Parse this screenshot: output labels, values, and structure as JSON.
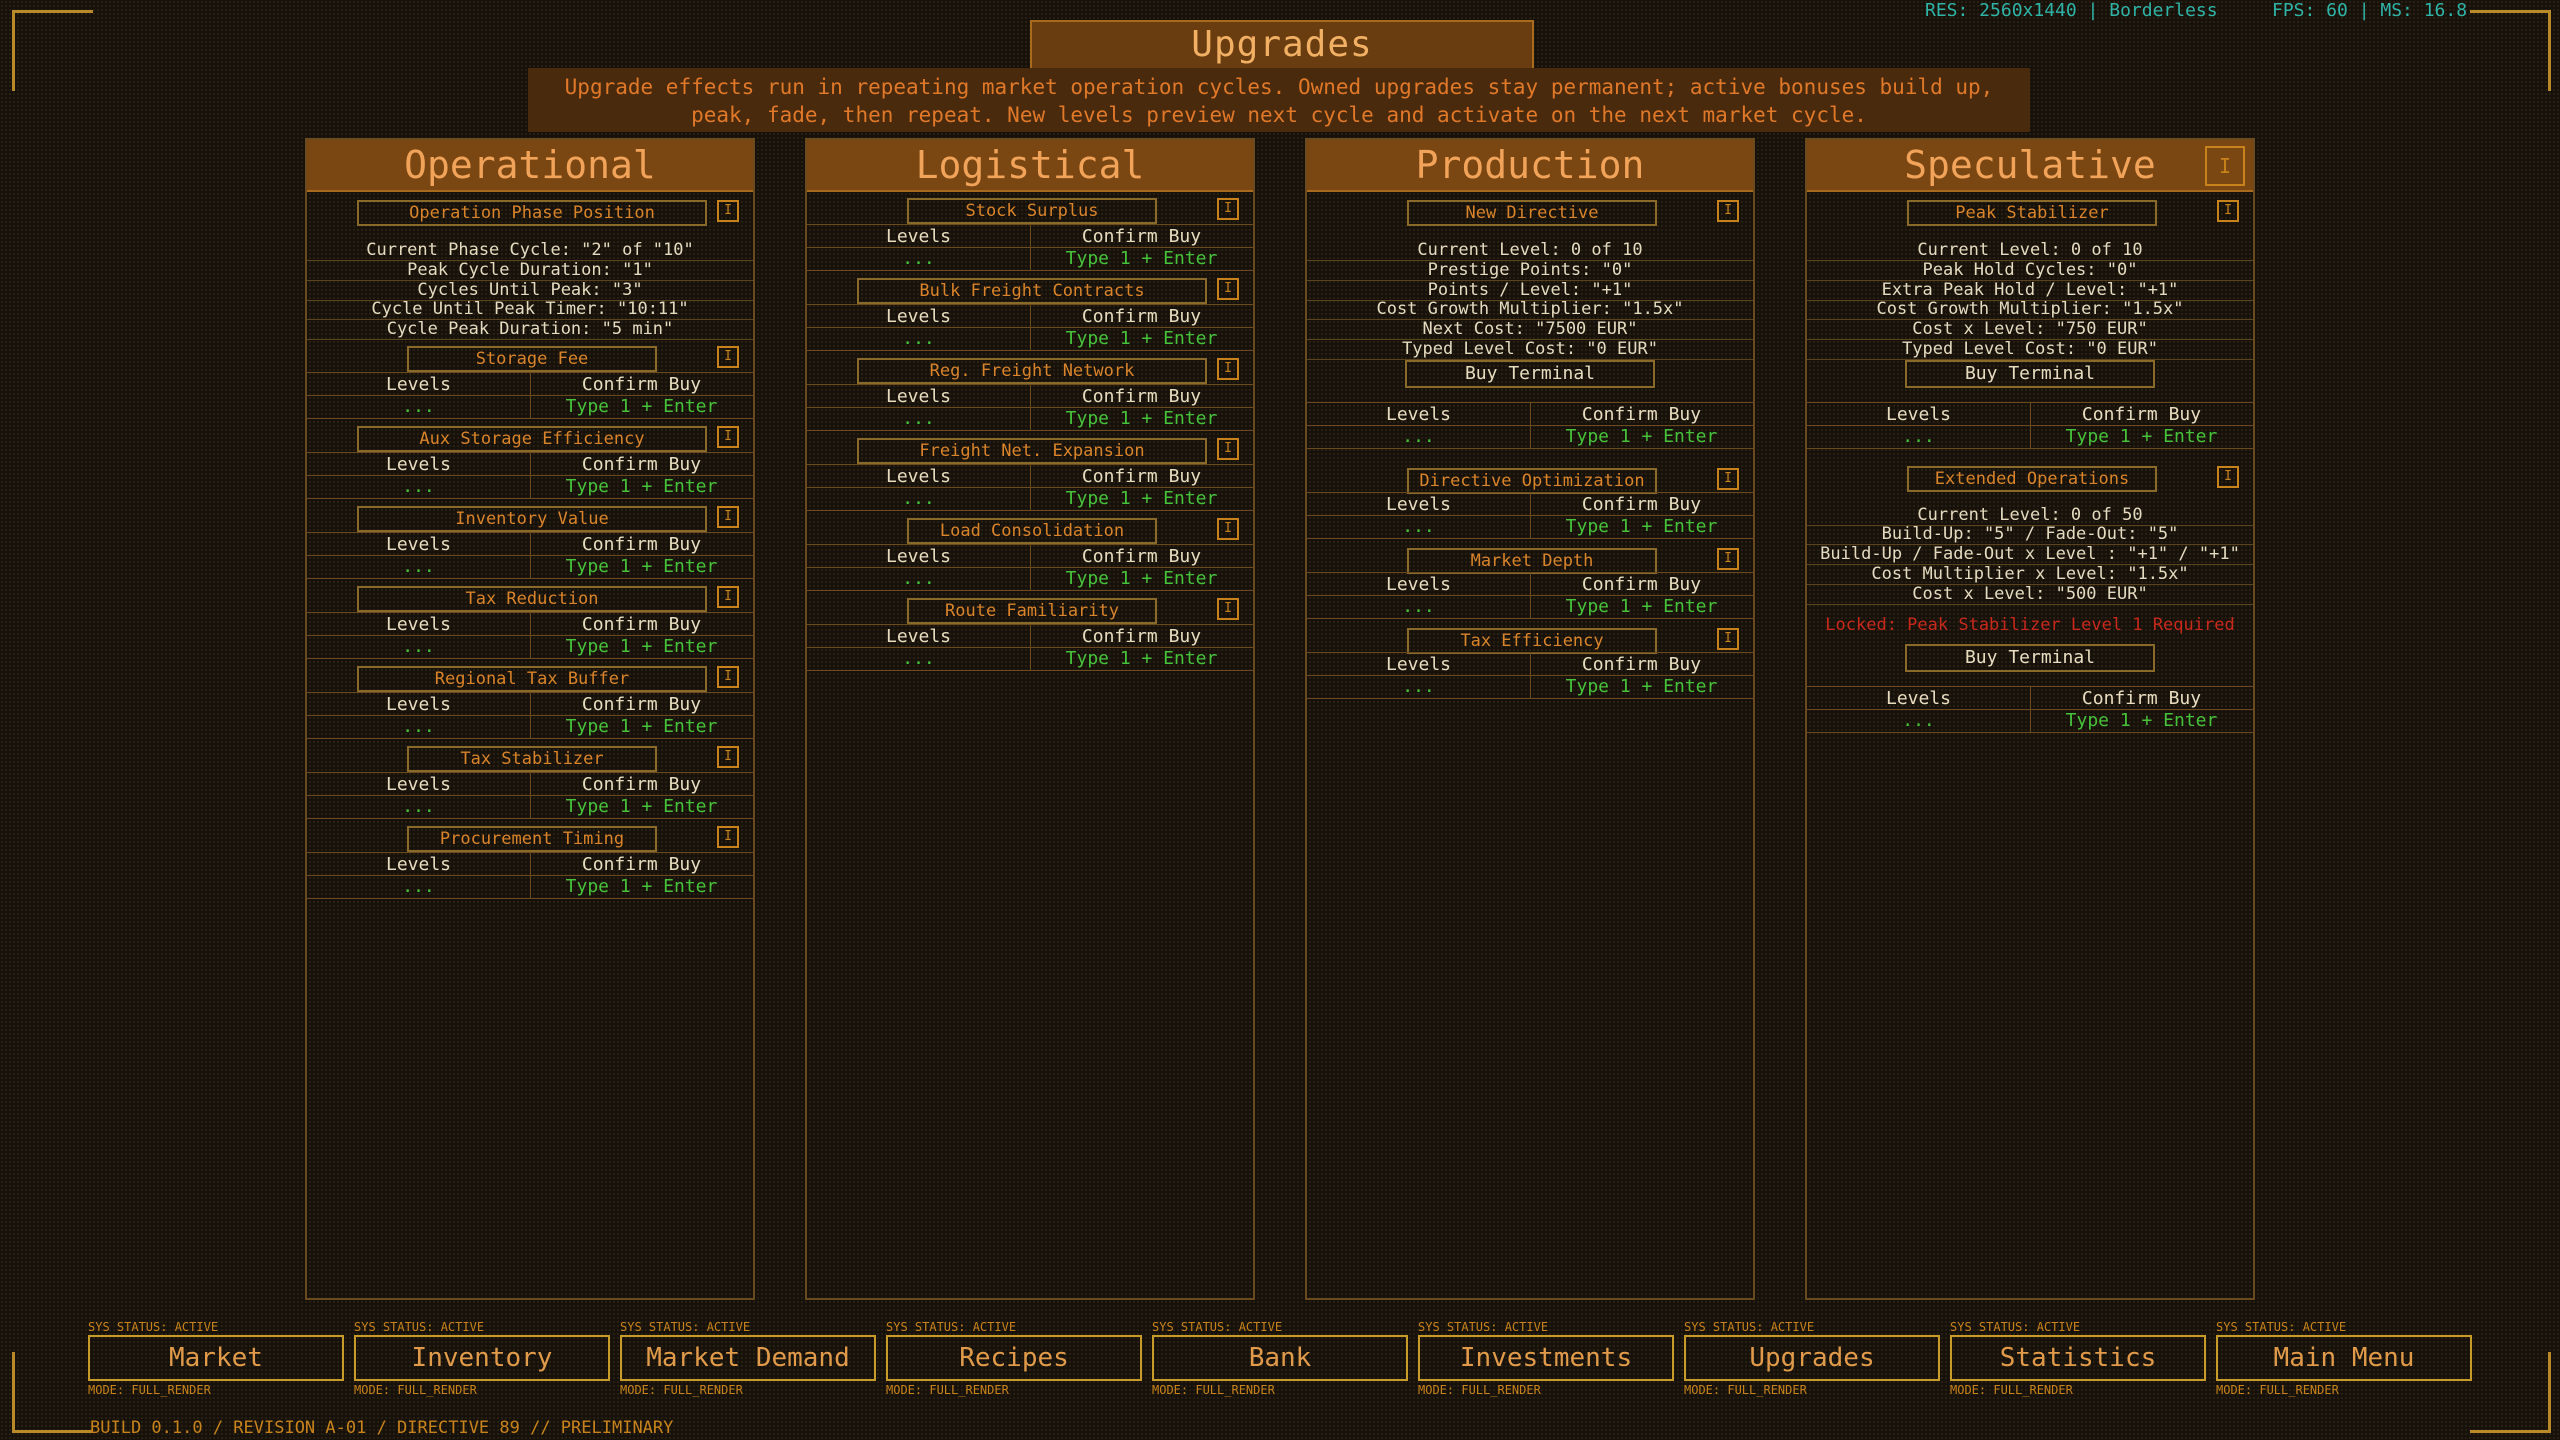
{
  "title": "Upgrades",
  "subtitle": [
    "Upgrade effects run in repeating market operation cycles. Owned upgrades stay permanent; active bonuses build up,",
    "peak, fade, then repeat. New levels preview next cycle and activate on the next market cycle."
  ],
  "status": {
    "res": "RES: 2560x1440 | Borderless",
    "fps": "FPS: 60 | MS: 16.8"
  },
  "common": {
    "levels": "Levels",
    "confirm": "Confirm Buy",
    "dots": "...",
    "type": "Type 1 + Enter",
    "buy_terminal": "Buy Terminal",
    "sec_btn": "I"
  },
  "columns": [
    {
      "title": "Operational"
    },
    {
      "title": "Logistical"
    },
    {
      "title": "Production"
    },
    {
      "title": "Speculative"
    }
  ],
  "operational": {
    "s1": {
      "title": "Operation Phase Position",
      "info": [
        "Current Phase Cycle: \"2\" of \"10\"",
        "Peak Cycle Duration: \"1\"",
        "Cycles Until Peak: \"3\"",
        "Cycle Until Peak Timer: \"10:11\"",
        "Cycle Peak Duration: \"5 min\""
      ]
    },
    "s2": {
      "title": "Storage Fee"
    },
    "s3": {
      "title": "Aux Storage Efficiency"
    },
    "s4": {
      "title": "Inventory Value"
    },
    "s5": {
      "title": "Tax Reduction"
    },
    "s6": {
      "title": "Regional Tax Buffer"
    },
    "s7": {
      "title": "Tax Stabilizer"
    },
    "s8": {
      "title": "Procurement Timing"
    }
  },
  "logistical": {
    "s1": {
      "title": "Stock Surplus"
    },
    "s2": {
      "title": "Bulk Freight Contracts"
    },
    "s3": {
      "title": "Reg. Freight Network"
    },
    "s4": {
      "title": "Freight Net. Expansion"
    },
    "s5": {
      "title": "Load Consolidation"
    },
    "s6": {
      "title": "Route Familiarity"
    }
  },
  "production": {
    "s1": {
      "title": "New Directive",
      "info": [
        "Current Level: 0 of 10",
        "Prestige Points: \"0\"",
        "Points / Level: \"+1\"",
        "Cost Growth Multiplier: \"1.5x\"",
        "Next Cost: \"7500 EUR\"",
        "Typed Level Cost: \"0 EUR\""
      ]
    },
    "s2": {
      "title": "Directive Optimization"
    },
    "s3": {
      "title": "Market Depth"
    },
    "s4": {
      "title": "Tax Efficiency"
    }
  },
  "speculative": {
    "s1": {
      "title": "Peak Stabilizer",
      "info": [
        "Current Level: 0 of 10",
        "Peak Hold Cycles: \"0\"",
        "Extra Peak Hold / Level: \"+1\"",
        "Cost Growth Multiplier: \"1.5x\"",
        "Cost x Level: \"750 EUR\"",
        "Typed Level Cost: \"0 EUR\""
      ]
    },
    "s2": {
      "title": "Extended Operations",
      "info": [
        "Current Level: 0 of 50",
        "Build-Up: \"5\"  /  Fade-Out: \"5\"",
        "Build-Up / Fade-Out x Level : \"+1\" / \"+1\"",
        "Cost Multiplier x Level: \"1.5x\"",
        "Cost x Level: \"500 EUR\""
      ],
      "locked": "Locked: Peak Stabilizer Level 1 Required"
    }
  },
  "nav": {
    "status": "SYS STATUS: ACTIVE",
    "mode": "MODE: FULL_RENDER",
    "items": [
      "Market",
      "Inventory",
      "Market Demand",
      "Recipes",
      "Bank",
      "Investments",
      "Upgrades",
      "Statistics",
      "Main Menu"
    ]
  },
  "footer": "BUILD 0.1.0 / REVISION A-01 / DIRECTIVE 89 // PRELIMINARY",
  "colors": {
    "accent": "#d97a1c",
    "green": "#46c23a",
    "cyan": "#2fb3a6",
    "locked": "#c8281c"
  }
}
